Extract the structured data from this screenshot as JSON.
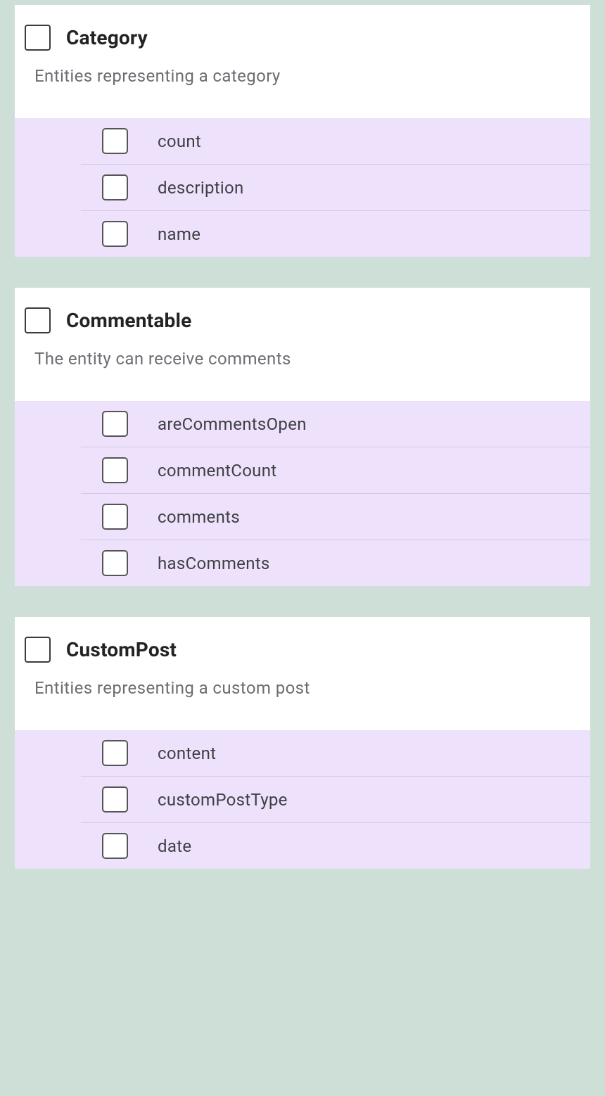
{
  "sections": [
    {
      "key": "category",
      "title": "Category",
      "description": "Entities representing a category",
      "fields": [
        {
          "key": "count",
          "label": "count"
        },
        {
          "key": "description",
          "label": "description"
        },
        {
          "key": "name",
          "label": "name"
        }
      ]
    },
    {
      "key": "commentable",
      "title": "Commentable",
      "description": "The entity can receive comments",
      "fields": [
        {
          "key": "areCommentsOpen",
          "label": "areCommentsOpen"
        },
        {
          "key": "commentCount",
          "label": "commentCount"
        },
        {
          "key": "comments",
          "label": "comments"
        },
        {
          "key": "hasComments",
          "label": "hasComments"
        }
      ]
    },
    {
      "key": "customPost",
      "title": "CustomPost",
      "description": "Entities representing a custom post",
      "fields": [
        {
          "key": "content",
          "label": "content"
        },
        {
          "key": "customPostType",
          "label": "customPostType"
        },
        {
          "key": "date",
          "label": "date"
        }
      ]
    }
  ]
}
